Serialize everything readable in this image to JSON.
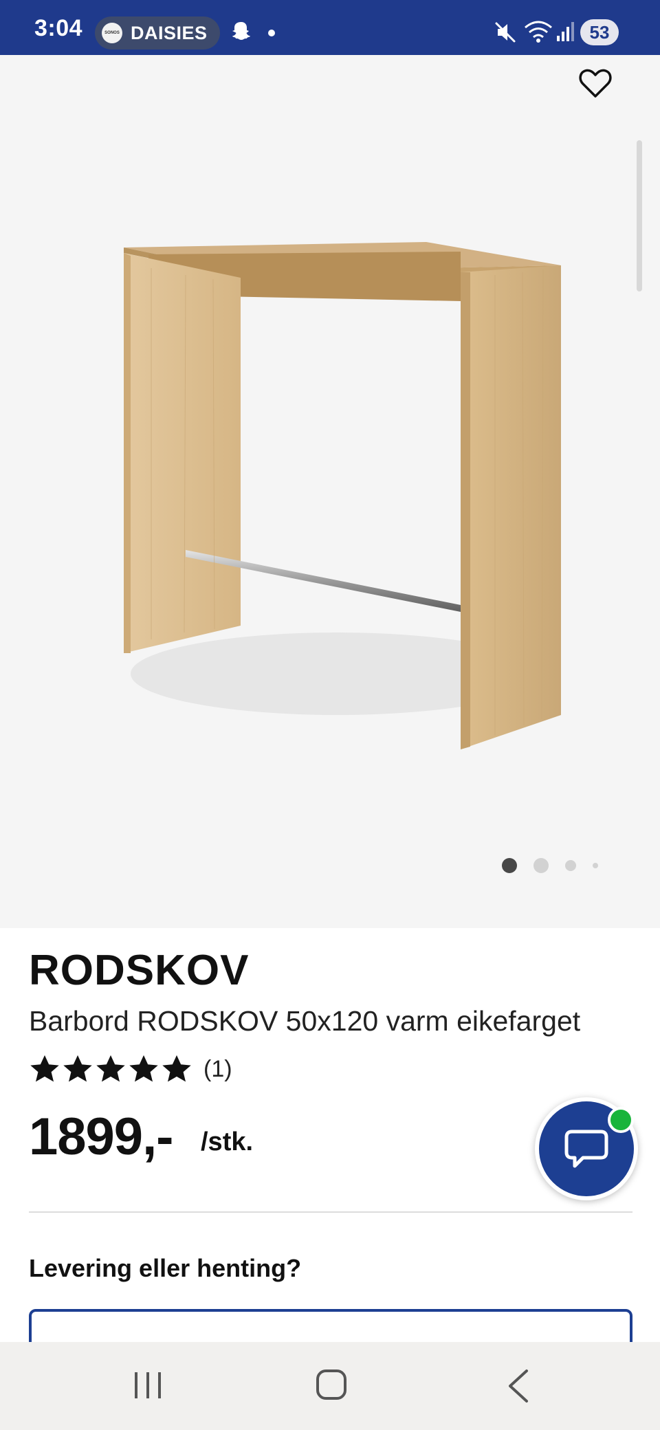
{
  "status_bar": {
    "time": "3:04",
    "media_app": "SONOS",
    "media_label": "DAISIES",
    "battery": "53",
    "icons": [
      "snapchat-icon",
      "mute-icon",
      "wifi-icon",
      "signal-icon",
      "battery-icon"
    ]
  },
  "gallery": {
    "image_alt": "Barbord RODSKOV eikefarget",
    "page_count": 4,
    "active_page": 1,
    "favorite_icon": "heart-outline"
  },
  "product": {
    "name": "RODSKOV",
    "description": "Barbord RODSKOV 50x120 varm eikefarget",
    "rating_stars": 5,
    "rating_count": "(1)",
    "price": "1899,-",
    "unit": "/stk."
  },
  "delivery": {
    "heading": "Levering eller henting?"
  },
  "colors": {
    "brand_blue": "#1d3f92",
    "status_bar": "#1f3a8c",
    "online_green": "#18b43b",
    "image_background": "#f5f5f5"
  },
  "nav": {
    "icons": [
      "recents-icon",
      "home-icon",
      "back-icon"
    ]
  }
}
